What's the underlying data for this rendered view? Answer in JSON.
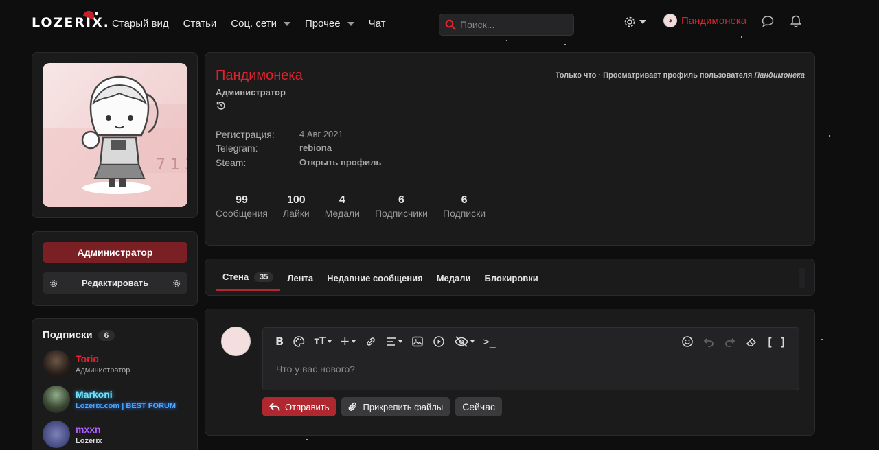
{
  "header": {
    "logo_text": "LOZERIX.",
    "nav": [
      {
        "label": "Старый вид",
        "dropdown": false
      },
      {
        "label": "Статьи",
        "dropdown": false
      },
      {
        "label": "Соц. сети",
        "dropdown": true
      },
      {
        "label": "Прочее",
        "dropdown": true
      },
      {
        "label": "Чат",
        "dropdown": false
      }
    ],
    "search_placeholder": "Поиск...",
    "username": "Пандимонека",
    "icons": [
      "gear-icon",
      "chat-icon",
      "bell-icon"
    ]
  },
  "profile": {
    "name": "Пандимонека",
    "role": "Администратор",
    "status_prefix": "Только что · Просматривает профиль пользователя",
    "status_user": "Пандимонека",
    "info": [
      {
        "key": "Регистрация:",
        "value": "4 Авг 2021",
        "strong": false
      },
      {
        "key": "Telegram:",
        "value": "rebiona",
        "strong": true
      },
      {
        "key": "Steam:",
        "value": "Открыть профиль",
        "strong": true
      }
    ],
    "stats": [
      {
        "num": "99",
        "label": "Сообщения"
      },
      {
        "num": "100",
        "label": "Лайки"
      },
      {
        "num": "4",
        "label": "Медали"
      },
      {
        "num": "6",
        "label": "Подписчики"
      },
      {
        "num": "6",
        "label": "Подписки"
      }
    ]
  },
  "sidebar": {
    "admin_button": "Администратор",
    "edit_button": "Редактировать",
    "subscriptions_title": "Подписки",
    "subscriptions_count": "6",
    "subs": [
      {
        "name": "Torio",
        "sub": "Администратор",
        "name_color": "#e0222e",
        "sub_color": "#aaaaaa"
      },
      {
        "name": "Markoni",
        "sub": "Lozerix.com | BEST FORUM",
        "name_color": "#6fe3ff",
        "sub_color": "#4aa8ff"
      },
      {
        "name": "mxxn",
        "sub": "Lozerix",
        "name_color": "#b05cff",
        "sub_color": "#dddddd"
      }
    ]
  },
  "tabs": [
    {
      "label": "Стена",
      "badge": "35",
      "active": true
    },
    {
      "label": "Лента",
      "badge": "",
      "active": false
    },
    {
      "label": "Недавние сообщения",
      "badge": "",
      "active": false
    },
    {
      "label": "Медали",
      "badge": "",
      "active": false
    },
    {
      "label": "Блокировки",
      "badge": "",
      "active": false
    }
  ],
  "composer": {
    "placeholder": "Что у вас нового?",
    "send": "Отправить",
    "attach": "Прикрепить файлы",
    "now": "Сейчас"
  },
  "colors": {
    "accent": "#e0222e",
    "panel": "#1b1b1c",
    "background": "#0e0e0f"
  }
}
